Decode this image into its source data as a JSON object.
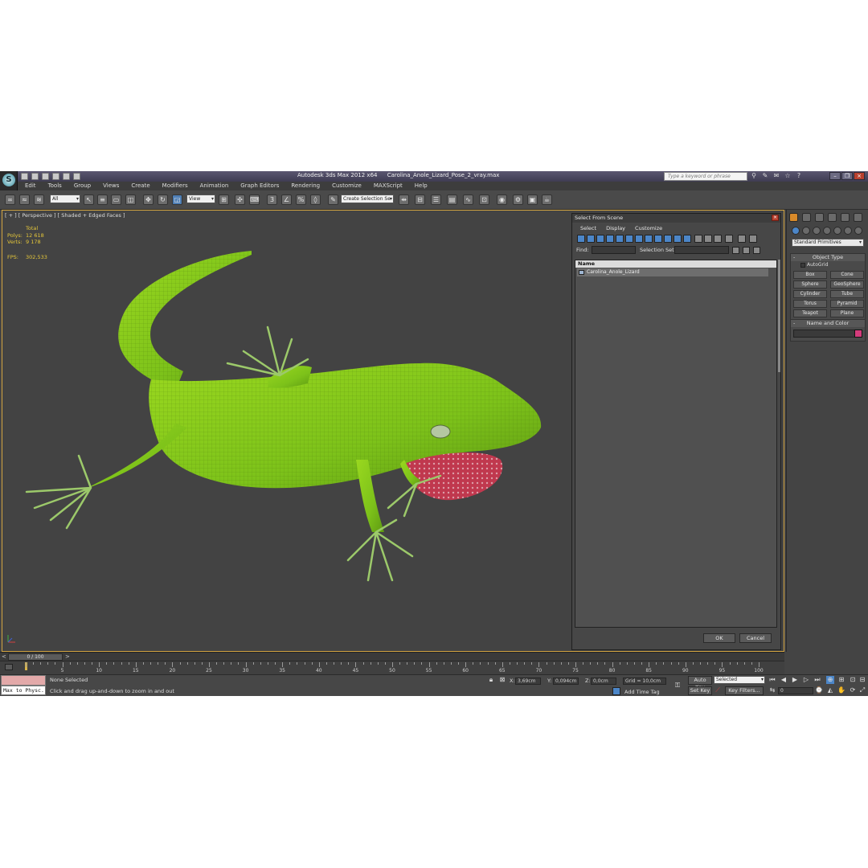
{
  "window": {
    "app_title": "Autodesk 3ds Max  2012 x64",
    "file_name": "Carolina_Anole_Lizard_Pose_2_vray.max",
    "search_placeholder": "Type a keyword or phrase"
  },
  "menu": [
    "Edit",
    "Tools",
    "Group",
    "Views",
    "Create",
    "Modifiers",
    "Animation",
    "Graph Editors",
    "Rendering",
    "Customize",
    "MAXScript",
    "Help"
  ],
  "toolbar": {
    "selection_filter": "All",
    "reference_coord": "View",
    "named_selection_set": "Create Selection Se"
  },
  "viewport": {
    "label": "[ + ] [ Perspective ] [ Shaded + Edged Faces ]",
    "stats": {
      "header": "Total",
      "polys_label": "Polys:",
      "polys_value": "12 618",
      "verts_label": "Verts:",
      "verts_value": "9 178",
      "fps_label": "FPS:",
      "fps_value": "302,533"
    }
  },
  "dialog": {
    "title": "Select From Scene",
    "tabs": [
      "Select",
      "Display",
      "Customize"
    ],
    "find_label": "Find:",
    "selection_set_label": "Selection Set:",
    "list_header": "Name",
    "items": [
      "Carolina_Anole_Lizard"
    ],
    "ok_label": "OK",
    "cancel_label": "Cancel"
  },
  "command_panel": {
    "category": "Standard Primitives",
    "object_type_header": "Object Type",
    "autogrid_label": "AutoGrid",
    "primitives": [
      "Box",
      "Cone",
      "Sphere",
      "GeoSphere",
      "Cylinder",
      "Tube",
      "Torus",
      "Pyramid",
      "Teapot",
      "Plane"
    ],
    "name_color_header": "Name and Color",
    "object_color": "#d43c7c"
  },
  "timeline": {
    "frame_display": "0 / 100",
    "ticks": [
      "5",
      "10",
      "15",
      "20",
      "25",
      "30",
      "35",
      "40",
      "45",
      "50",
      "55",
      "60",
      "65",
      "70",
      "75",
      "80",
      "85",
      "90",
      "95",
      "100"
    ]
  },
  "status": {
    "listener_text": "Max to Physc.",
    "selection_status": "None Selected",
    "prompt": "Click and drag up-and-down to zoom in and out",
    "x_label": "X:",
    "x_value": "3,69cm",
    "y_label": "Y:",
    "y_value": "0,094cm",
    "z_label": "Z:",
    "z_value": "0,0cm",
    "grid": "Grid = 10,0cm",
    "add_time_tag": "Add Time Tag",
    "auto_key": "Auto Key",
    "set_key": "Set Key",
    "key_mode": "Selected",
    "key_filters": "Key Filters...",
    "current_frame": "0"
  },
  "colors": {
    "viewport_bg": "#434343",
    "ui_bg": "#444444",
    "stats_text": "#e4c63a",
    "active_border": "#d3a542",
    "lizard_skin": "#8ccf1e",
    "dewlap": "#c0384e"
  }
}
